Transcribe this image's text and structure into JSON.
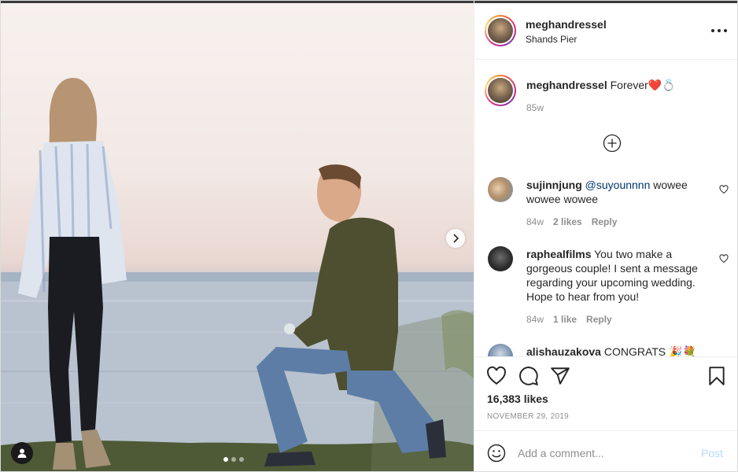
{
  "post": {
    "username": "meghandressel",
    "location": "Shands Pier",
    "more_icon": "more-horizontal-icon"
  },
  "caption": {
    "username": "meghandressel",
    "text": "Forever❤️💍",
    "age": "85w"
  },
  "comments": [
    {
      "username": "sujinnjung",
      "mention": "@suyounnnn",
      "text": " wowee wowee wowee",
      "age": "84w",
      "likes": "2 likes",
      "reply": "Reply"
    },
    {
      "username": "raphealfilms",
      "mention": "",
      "text": " You two make a gorgeous couple! I sent a message regarding your upcoming wedding. Hope to hear from you!",
      "age": "84w",
      "likes": "1 like",
      "reply": "Reply"
    },
    {
      "username": "alishauzakova",
      "mention": "",
      "text": " CONGRATS 🎉💐",
      "age": "",
      "likes": "",
      "reply": ""
    }
  ],
  "stats": {
    "likes": "16,383 likes",
    "date": "NOVEMBER 29, 2019"
  },
  "composer": {
    "placeholder": "Add a comment...",
    "post_label": "Post"
  },
  "carousel": {
    "slides": 3,
    "active_slide": 1
  },
  "colors": {
    "text": "#262626",
    "secondary": "#8e8e8e",
    "link": "#00376b",
    "post_disabled": "#b3dbff",
    "border": "#efefef"
  }
}
